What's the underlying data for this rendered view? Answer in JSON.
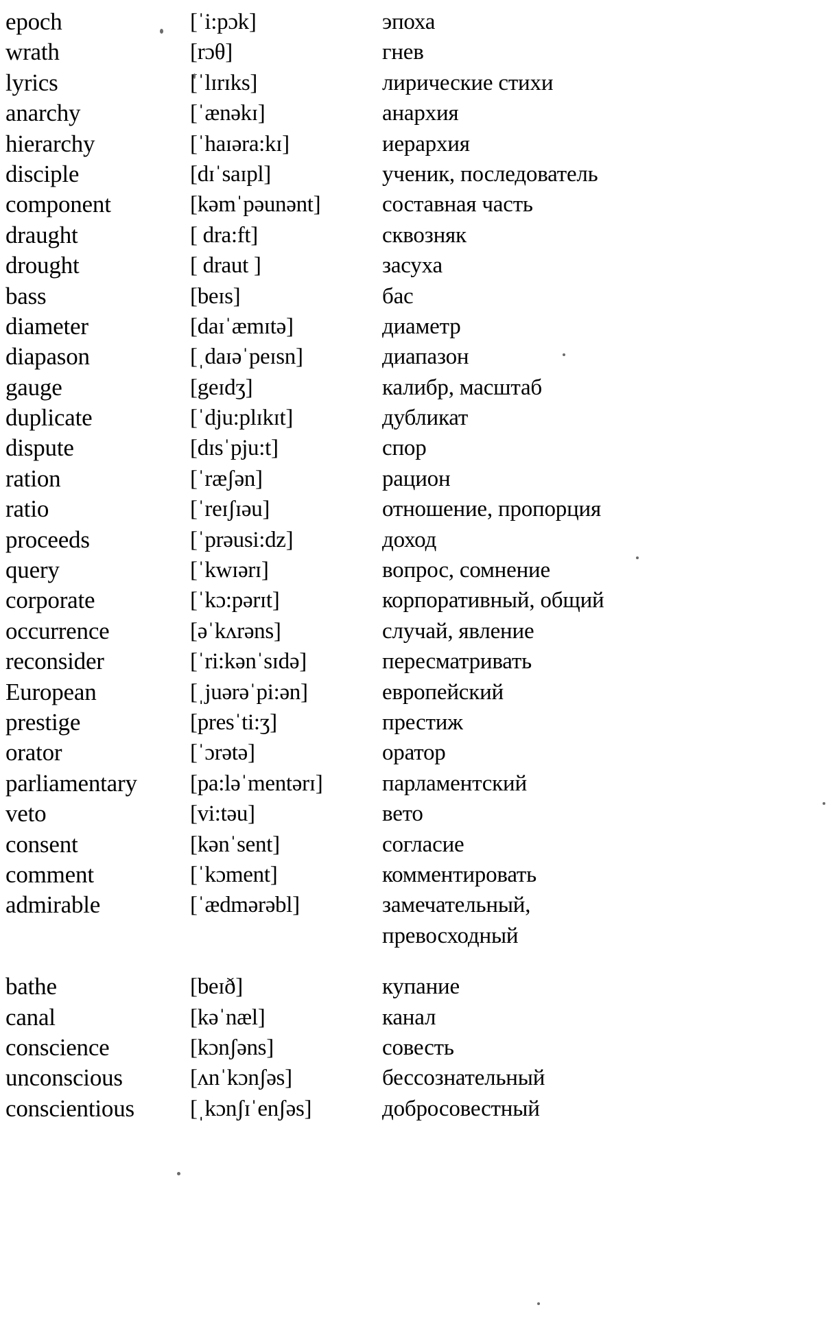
{
  "document": {
    "kind": "vocabulary-list",
    "columns": [
      "word",
      "transcription",
      "translation"
    ],
    "entries": [
      {
        "word": "epoch",
        "ipa": "[ˈi:pɔk]",
        "ru": [
          "эпоха"
        ]
      },
      {
        "word": "wrath",
        "ipa": "[rɔθ]",
        "ru": [
          "гнев"
        ]
      },
      {
        "word": "lyrics",
        "ipa": "[ˈlɪrɪks]",
        "ru": [
          "лирические стихи"
        ]
      },
      {
        "word": "anarchy",
        "ipa": "[ˈænəkɪ]",
        "ru": [
          "анархия"
        ]
      },
      {
        "word": "hierarchy",
        "ipa": "[ˈhaɪəra:kɪ]",
        "ru": [
          "иерархия"
        ]
      },
      {
        "word": "disciple",
        "ipa": "[dɪˈsaɪpl]",
        "ru": [
          "ученик, последователь"
        ]
      },
      {
        "word": "component",
        "ipa": "[kəmˈpəunənt]",
        "ru": [
          "составная часть"
        ]
      },
      {
        "word": "draught",
        "ipa": "[ dra:ft]",
        "ru": [
          "сквозняк"
        ]
      },
      {
        "word": "drought",
        "ipa": "[ draut ]",
        "ru": [
          "засуха"
        ]
      },
      {
        "word": "bass",
        "ipa": "[beɪs]",
        "ru": [
          "бас"
        ]
      },
      {
        "word": "diameter",
        "ipa": "[daɪˈæmɪtə]",
        "ru": [
          "диаметр"
        ]
      },
      {
        "word": "diapason",
        "ipa": "[ˌdaɪəˈpeɪsn]",
        "ru": [
          "диапазон"
        ]
      },
      {
        "word": "gauge",
        "ipa": "[geɪdʒ]",
        "ru": [
          "калибр, масштаб"
        ]
      },
      {
        "word": "duplicate",
        "ipa": "[ˈdju:plɪkɪt]",
        "ru": [
          "дубликат"
        ]
      },
      {
        "word": "dispute",
        "ipa": "[dɪsˈpju:t]",
        "ru": [
          "спор"
        ]
      },
      {
        "word": "ration",
        "ipa": "[ˈræʃən]",
        "ru": [
          "рацион"
        ]
      },
      {
        "word": "ratio",
        "ipa": "[ˈreɪʃɪəu]",
        "ru": [
          "отношение, пропорция"
        ]
      },
      {
        "word": "proceeds",
        "ipa": "[ˈprəusi:dz]",
        "ru": [
          "доход"
        ]
      },
      {
        "word": "query",
        "ipa": "[ˈkwɪərɪ]",
        "ru": [
          "вопрос, сомнение"
        ]
      },
      {
        "word": "corporate",
        "ipa": "[ˈkɔ:pərɪt]",
        "ru": [
          "корпоративный, общий"
        ]
      },
      {
        "word": "occurrence",
        "ipa": "[əˈkʌrəns]",
        "ru": [
          "случай, явление"
        ]
      },
      {
        "word": "reconsider",
        "ipa": "[ˈri:kənˈsɪdə]",
        "ru": [
          "пересматривать"
        ]
      },
      {
        "word": "European",
        "ipa": "[ˌjuərəˈpi:ən]",
        "ru": [
          "европейский"
        ]
      },
      {
        "word": "prestige",
        "ipa": "[presˈti:ʒ]",
        "ru": [
          "престиж"
        ]
      },
      {
        "word": "orator",
        "ipa": "[ˈɔrətə]",
        "ru": [
          "оратор"
        ]
      },
      {
        "word": "parliamentary",
        "ipa": "[pa:ləˈmentərɪ]",
        "ru": [
          "парламентский"
        ]
      },
      {
        "word": "veto",
        "ipa": "[vi:təu]",
        "ru": [
          "вето"
        ]
      },
      {
        "word": "consent",
        "ipa": "[kənˈsent]",
        "ru": [
          "согласие"
        ]
      },
      {
        "word": "comment",
        "ipa": "[ˈkɔment]",
        "ru": [
          "комментировать"
        ]
      },
      {
        "word": "admirable",
        "ipa": "[ˈædmərəbl]",
        "ru": [
          "замечательный,",
          "превосходный"
        ]
      },
      {
        "word": "bathe",
        "ipa": "[beɪð]",
        "ru": [
          "купание"
        ],
        "gap_before": true
      },
      {
        "word": "canal",
        "ipa": "[kəˈnæl]",
        "ru": [
          "канал"
        ]
      },
      {
        "word": "conscience",
        "ipa": "[kɔnʃəns]",
        "ru": [
          "совесть"
        ]
      },
      {
        "word": "unconscious",
        "ipa": "[ʌnˈkɔnʃəs]",
        "ru": [
          "бессознательный"
        ]
      },
      {
        "word": "conscientious",
        "ipa": "[ˌkɔnʃɪˈenʃəs]",
        "ru": [
          "добросовестный"
        ]
      }
    ]
  }
}
